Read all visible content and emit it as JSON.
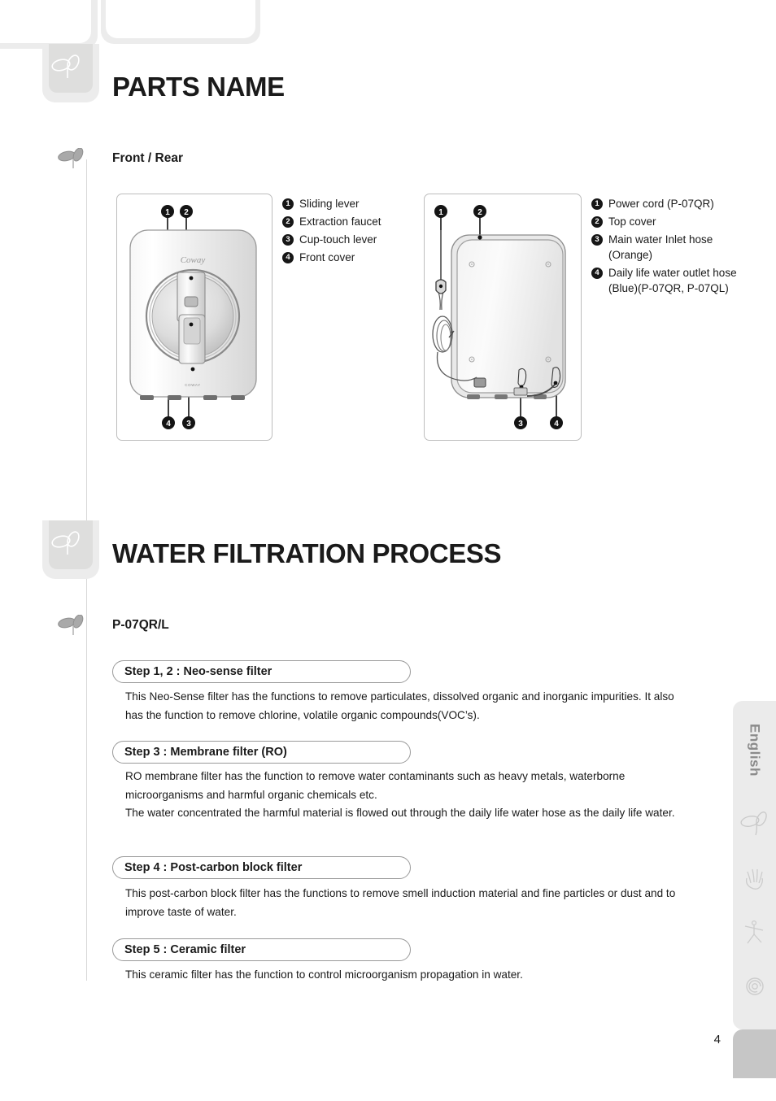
{
  "page": {
    "number": "4",
    "language_tab": "English"
  },
  "chapters": [
    {
      "title": "PARTS NAME",
      "subheading": "Front / Rear"
    },
    {
      "title": "WATER FILTRATION PROCESS",
      "subheading": "P-07QR/L"
    }
  ],
  "figures": {
    "front": {
      "caption": "Front view of water purifier",
      "brand_text": "Coway",
      "callout_numbers": [
        "1",
        "2",
        "3",
        "4"
      ]
    },
    "rear": {
      "caption": "Rear view of water purifier",
      "callout_numbers": [
        "1",
        "2",
        "3",
        "4"
      ]
    }
  },
  "front_parts": [
    {
      "num": "❶",
      "label": "Sliding lever"
    },
    {
      "num": "❷",
      "label": "Extraction faucet"
    },
    {
      "num": "❸",
      "label": "Cup-touch lever"
    },
    {
      "num": "❹",
      "label": "Front cover"
    }
  ],
  "rear_parts": [
    {
      "num": "❶",
      "label": "Power cord (P-07QR)"
    },
    {
      "num": "❷",
      "label": "Top cover"
    },
    {
      "num": "❸",
      "label": "Main water Inlet hose (Orange)"
    },
    {
      "num": "❹",
      "label": "Daily life water outlet hose (Blue)(P-07QR, P-07QL)"
    }
  ],
  "steps": [
    {
      "header": "Step 1, 2 : Neo-sense filter",
      "body": "This Neo-Sense filter has the functions to remove particulates, dissolved organic and inorganic impurities. It also has the function to remove chlorine, volatile organic compounds(VOC’s)."
    },
    {
      "header": "Step 3 : Membrane filter (RO)",
      "body": "RO membrane filter has the function to remove water contaminants such as heavy metals, waterborne microorganisms and harmful organic chemicals etc.\nThe water concentrated the harmful material is flowed out through the daily life water hose as the daily life water."
    },
    {
      "header": "Step 4 : Post-carbon block filter",
      "body": "This post-carbon block filter has the functions to remove smell induction material and fine particles or dust and to improve taste of water."
    },
    {
      "header": "Step 5 : Ceramic filter",
      "body": "This ceramic filter has the function to control microorganism propagation in water."
    }
  ],
  "sidebar_icons": [
    "sprout-icon",
    "hand-icon",
    "figure-icon",
    "spiral-icon"
  ],
  "colors": {
    "accent_gray": "#ececec",
    "marker_gray": "#dededd",
    "text": "#1a1a1a",
    "pill_border": "#9a9a9a",
    "sidebar_bg": "#ebebeb",
    "sidebar_foot": "#c6c6c6"
  }
}
